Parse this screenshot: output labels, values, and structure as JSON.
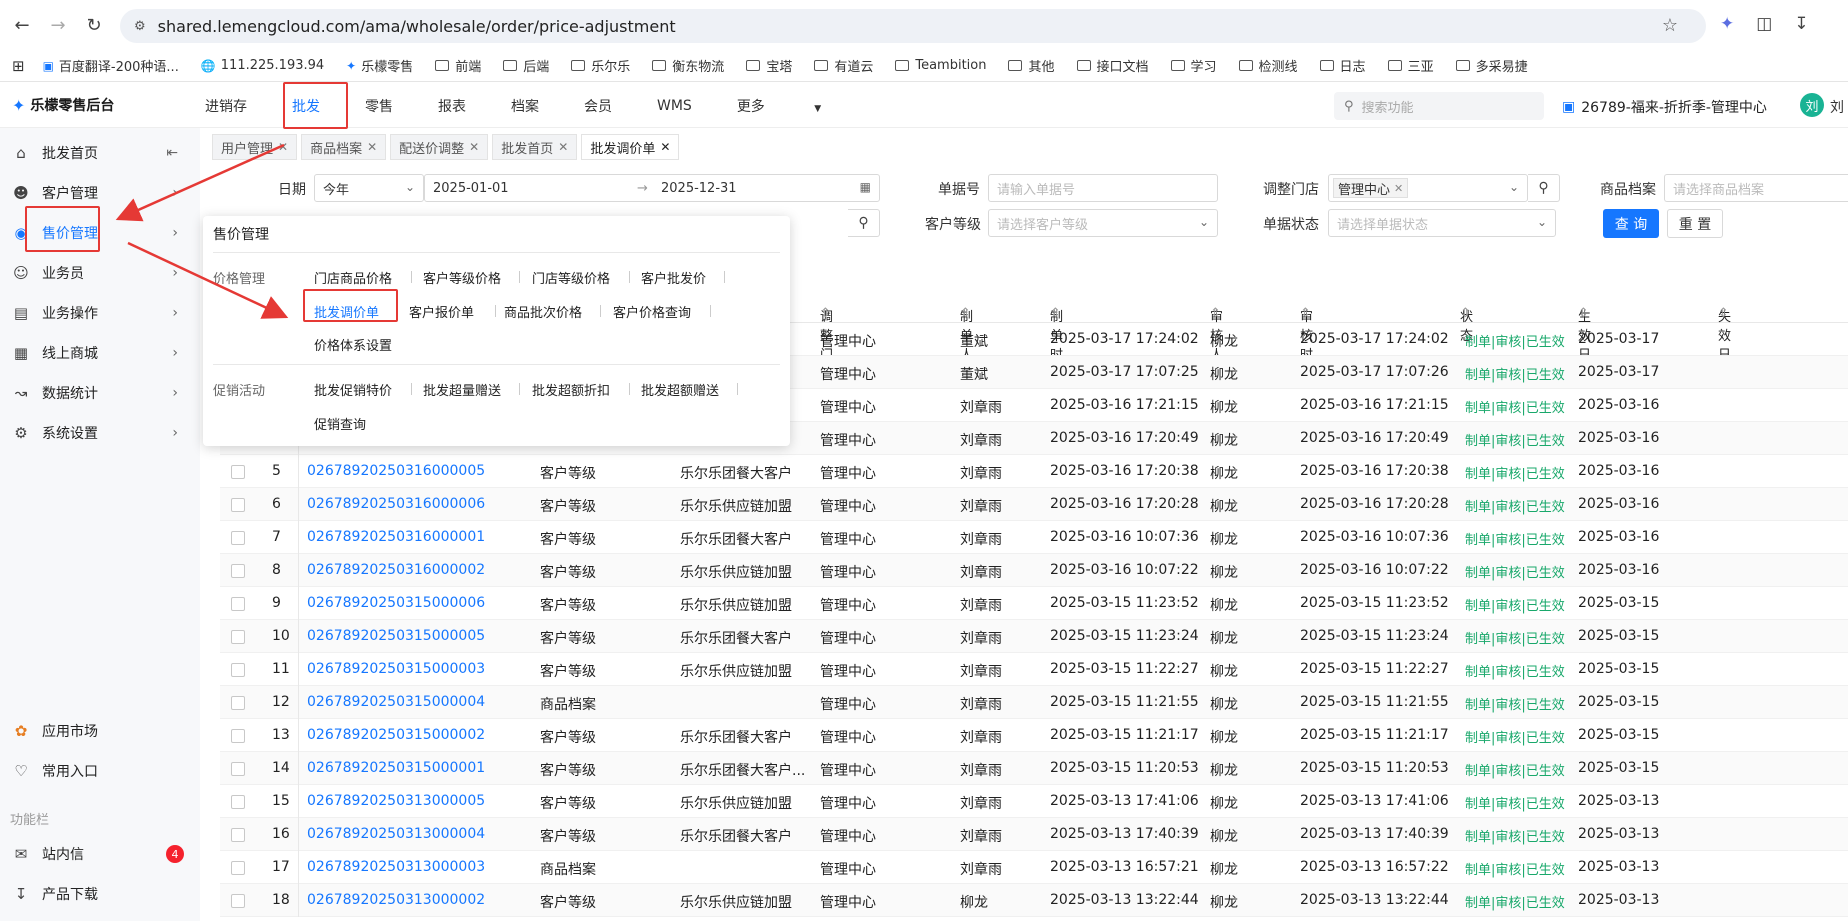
{
  "browser": {
    "url": "shared.lemengcloud.com/ama/wholesale/order/price-adjustment",
    "bookmarks": [
      "百度翻译-200种语...",
      "111.225.193.94",
      "乐檬零售",
      "前端",
      "后端",
      "乐尔乐",
      "衡东物流",
      "宝塔",
      "有道云",
      "Teambition",
      "其他",
      "接口文档",
      "学习",
      "检测线",
      "日志",
      "三亚",
      "多采易捷"
    ]
  },
  "app": {
    "logo": "乐檬零售后台",
    "top_nav": [
      "进销存",
      "批发",
      "零售",
      "报表",
      "档案",
      "会员",
      "WMS",
      "更多"
    ],
    "search_placeholder": "搜索功能",
    "store": "26789-福来-折折季-管理中心",
    "user_initial": "刘",
    "user_name": "刘"
  },
  "sidebar": {
    "items": [
      "批发首页",
      "客户管理",
      "售价管理",
      "业务员",
      "业务操作",
      "线上商城",
      "数据统计",
      "系统设置"
    ],
    "bottom_items": [
      "应用市场",
      "常用入口"
    ],
    "section_label": "功能栏",
    "footer_items": [
      "站内信",
      "产品下载"
    ],
    "message_count": "4"
  },
  "tabs": [
    "用户管理",
    "商品档案",
    "配送价调整",
    "批发首页",
    "批发调价单"
  ],
  "filters": {
    "date_label": "日期",
    "date_range": "今年",
    "date_start": "2025-01-01",
    "date_end": "2025-12-31",
    "order_no_label": "单据号",
    "order_no_placeholder": "请输入单据号",
    "store_label": "调整门店",
    "store_tag": "管理中心",
    "product_label": "商品档案",
    "product_placeholder": "请选择商品档案",
    "customer_level_label": "客户等级",
    "customer_level_placeholder": "请选择客户等级",
    "status_label": "单据状态",
    "status_placeholder": "请选择单据状态",
    "query_btn": "查 询",
    "reset_btn": "重 置"
  },
  "table": {
    "headers": [
      "调整门店",
      "制单人",
      "制单时间",
      "审核人",
      "审核时间",
      "状态",
      "生效日期",
      "失效日期"
    ],
    "rows": [
      {
        "no": "",
        "id": "",
        "type": "",
        "customer": "",
        "store": "管理中心",
        "maker": "董斌",
        "make_time": "2025-03-17 17:24:02",
        "auditor": "柳龙",
        "audit_time": "2025-03-17 17:24:02",
        "status": "制单|审核|已生效",
        "eff": "2025-03-17"
      },
      {
        "no": "",
        "id": "",
        "type": "",
        "customer": "",
        "store": "管理中心",
        "maker": "董斌",
        "make_time": "2025-03-17 17:07:25",
        "auditor": "柳龙",
        "audit_time": "2025-03-17 17:07:26",
        "status": "制单|审核|已生效",
        "eff": "2025-03-17"
      },
      {
        "no": "",
        "id": "",
        "type": "",
        "customer": "",
        "store": "管理中心",
        "maker": "刘章雨",
        "make_time": "2025-03-16 17:21:15",
        "auditor": "柳龙",
        "audit_time": "2025-03-16 17:21:15",
        "status": "制单|审核|已生效",
        "eff": "2025-03-16"
      },
      {
        "no": "",
        "id": "",
        "type": "",
        "customer": "",
        "store": "管理中心",
        "maker": "刘章雨",
        "make_time": "2025-03-16 17:20:49",
        "auditor": "柳龙",
        "audit_time": "2025-03-16 17:20:49",
        "status": "制单|审核|已生效",
        "eff": "2025-03-16"
      },
      {
        "no": "5",
        "id": "02678920250316000005",
        "type": "客户等级",
        "customer": "乐尔乐团餐大客户",
        "store": "管理中心",
        "maker": "刘章雨",
        "make_time": "2025-03-16 17:20:38",
        "auditor": "柳龙",
        "audit_time": "2025-03-16 17:20:38",
        "status": "制单|审核|已生效",
        "eff": "2025-03-16"
      },
      {
        "no": "6",
        "id": "02678920250316000006",
        "type": "客户等级",
        "customer": "乐尔乐供应链加盟",
        "store": "管理中心",
        "maker": "刘章雨",
        "make_time": "2025-03-16 17:20:28",
        "auditor": "柳龙",
        "audit_time": "2025-03-16 17:20:28",
        "status": "制单|审核|已生效",
        "eff": "2025-03-16"
      },
      {
        "no": "7",
        "id": "02678920250316000001",
        "type": "客户等级",
        "customer": "乐尔乐团餐大客户",
        "store": "管理中心",
        "maker": "刘章雨",
        "make_time": "2025-03-16 10:07:36",
        "auditor": "柳龙",
        "audit_time": "2025-03-16 10:07:36",
        "status": "制单|审核|已生效",
        "eff": "2025-03-16"
      },
      {
        "no": "8",
        "id": "02678920250316000002",
        "type": "客户等级",
        "customer": "乐尔乐供应链加盟",
        "store": "管理中心",
        "maker": "刘章雨",
        "make_time": "2025-03-16 10:07:22",
        "auditor": "柳龙",
        "audit_time": "2025-03-16 10:07:22",
        "status": "制单|审核|已生效",
        "eff": "2025-03-16"
      },
      {
        "no": "9",
        "id": "02678920250315000006",
        "type": "客户等级",
        "customer": "乐尔乐供应链加盟",
        "store": "管理中心",
        "maker": "刘章雨",
        "make_time": "2025-03-15 11:23:52",
        "auditor": "柳龙",
        "audit_time": "2025-03-15 11:23:52",
        "status": "制单|审核|已生效",
        "eff": "2025-03-15"
      },
      {
        "no": "10",
        "id": "02678920250315000005",
        "type": "客户等级",
        "customer": "乐尔乐团餐大客户",
        "store": "管理中心",
        "maker": "刘章雨",
        "make_time": "2025-03-15 11:23:24",
        "auditor": "柳龙",
        "audit_time": "2025-03-15 11:23:24",
        "status": "制单|审核|已生效",
        "eff": "2025-03-15"
      },
      {
        "no": "11",
        "id": "02678920250315000003",
        "type": "客户等级",
        "customer": "乐尔乐供应链加盟",
        "store": "管理中心",
        "maker": "刘章雨",
        "make_time": "2025-03-15 11:22:27",
        "auditor": "柳龙",
        "audit_time": "2025-03-15 11:22:27",
        "status": "制单|审核|已生效",
        "eff": "2025-03-15"
      },
      {
        "no": "12",
        "id": "02678920250315000004",
        "type": "商品档案",
        "customer": "",
        "store": "管理中心",
        "maker": "刘章雨",
        "make_time": "2025-03-15 11:21:55",
        "auditor": "柳龙",
        "audit_time": "2025-03-15 11:21:55",
        "status": "制单|审核|已生效",
        "eff": "2025-03-15"
      },
      {
        "no": "13",
        "id": "02678920250315000002",
        "type": "客户等级",
        "customer": "乐尔乐团餐大客户",
        "store": "管理中心",
        "maker": "刘章雨",
        "make_time": "2025-03-15 11:21:17",
        "auditor": "柳龙",
        "audit_time": "2025-03-15 11:21:17",
        "status": "制单|审核|已生效",
        "eff": "2025-03-15"
      },
      {
        "no": "14",
        "id": "02678920250315000001",
        "type": "客户等级",
        "customer": "乐尔乐团餐大客户...",
        "store": "管理中心",
        "maker": "刘章雨",
        "make_time": "2025-03-15 11:20:53",
        "auditor": "柳龙",
        "audit_time": "2025-03-15 11:20:53",
        "status": "制单|审核|已生效",
        "eff": "2025-03-15"
      },
      {
        "no": "15",
        "id": "02678920250313000005",
        "type": "客户等级",
        "customer": "乐尔乐供应链加盟",
        "store": "管理中心",
        "maker": "刘章雨",
        "make_time": "2025-03-13 17:41:06",
        "auditor": "柳龙",
        "audit_time": "2025-03-13 17:41:06",
        "status": "制单|审核|已生效",
        "eff": "2025-03-13"
      },
      {
        "no": "16",
        "id": "02678920250313000004",
        "type": "客户等级",
        "customer": "乐尔乐团餐大客户",
        "store": "管理中心",
        "maker": "刘章雨",
        "make_time": "2025-03-13 17:40:39",
        "auditor": "柳龙",
        "audit_time": "2025-03-13 17:40:39",
        "status": "制单|审核|已生效",
        "eff": "2025-03-13"
      },
      {
        "no": "17",
        "id": "02678920250313000003",
        "type": "商品档案",
        "customer": "",
        "store": "管理中心",
        "maker": "刘章雨",
        "make_time": "2025-03-13 16:57:21",
        "auditor": "柳龙",
        "audit_time": "2025-03-13 16:57:22",
        "status": "制单|审核|已生效",
        "eff": "2025-03-13"
      },
      {
        "no": "18",
        "id": "02678920250313000002",
        "type": "客户等级",
        "customer": "乐尔乐供应链加盟",
        "store": "管理中心",
        "maker": "柳龙",
        "make_time": "2025-03-13 13:22:44",
        "auditor": "柳龙",
        "audit_time": "2025-03-13 13:22:44",
        "status": "制单|审核|已生效",
        "eff": "2025-03-13"
      }
    ]
  },
  "flyout": {
    "title": "售价管理",
    "price_cat": "价格管理",
    "price_items_row1": [
      "门店商品价格",
      "客户等级价格",
      "门店等级价格",
      "客户批发价"
    ],
    "price_items_row2": [
      "批发调价单",
      "客户报价单",
      "商品批次价格",
      "客户价格查询"
    ],
    "price_items_row3": [
      "价格体系设置"
    ],
    "promo_cat": "促销活动",
    "promo_items_row1": [
      "批发促销特价",
      "批发超量赠送",
      "批发超额折扣",
      "批发超额赠送"
    ],
    "promo_items_row2": [
      "促销查询"
    ]
  },
  "annotation_color": "#e53935",
  "accent_color": "#1677ff"
}
